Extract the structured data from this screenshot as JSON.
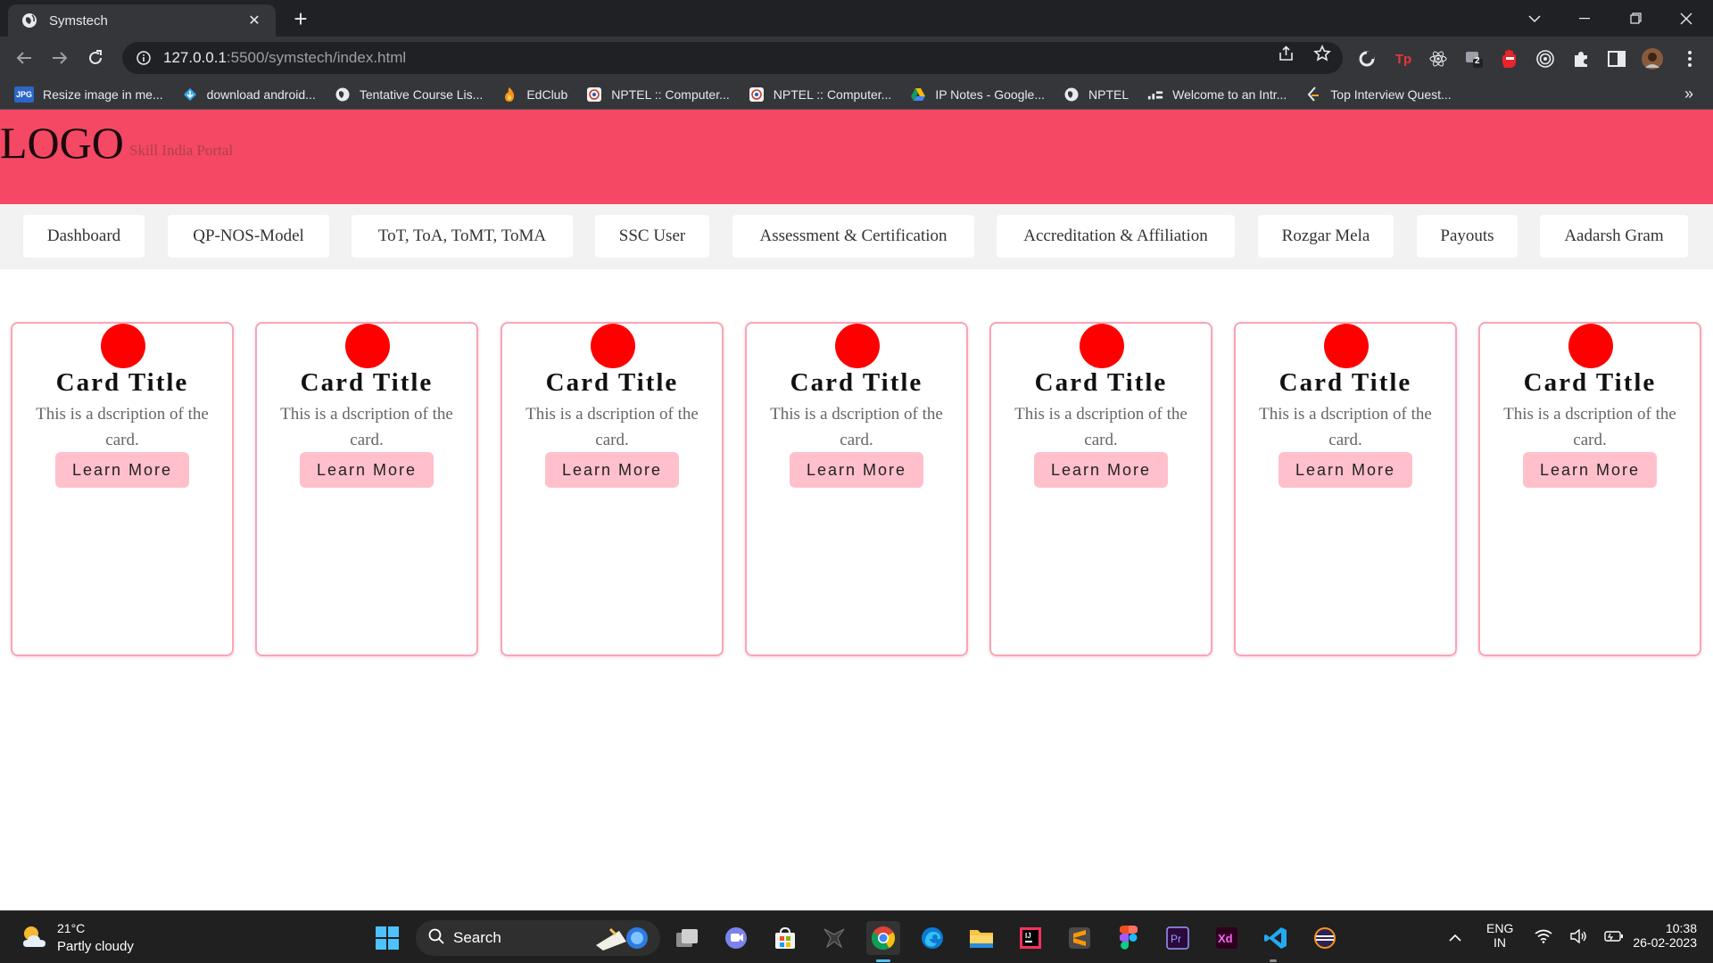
{
  "browser": {
    "tab": {
      "title": "Symstech",
      "favicon": "globe-icon"
    },
    "address": {
      "host": "127.0.0.1",
      "path": ":5500/symstech/index.html"
    },
    "bookmarks": [
      {
        "label": "Resize image in me...",
        "icon": "jpg-icon"
      },
      {
        "label": "download android...",
        "icon": "download-icon"
      },
      {
        "label": "Tentative Course Lis...",
        "icon": "globe-icon"
      },
      {
        "label": "EdClub",
        "icon": "edclub-icon"
      },
      {
        "label": "NPTEL :: Computer...",
        "icon": "nptel-icon"
      },
      {
        "label": "NPTEL :: Computer...",
        "icon": "nptel-icon"
      },
      {
        "label": "IP Notes - Google...",
        "icon": "drive-icon"
      },
      {
        "label": "NPTEL",
        "icon": "globe-icon"
      },
      {
        "label": "Welcome to an Intr...",
        "icon": "chart-icon"
      },
      {
        "label": "Top Interview Quest...",
        "icon": "leetcode-icon"
      }
    ],
    "bookmarks_more": "»",
    "extension_badge": "2"
  },
  "page": {
    "logo": "LOGO",
    "portal_name": "Skill India Portal",
    "nav": [
      "Dashboard",
      "QP-NOS-Model",
      "ToT, ToA, ToMT, ToMA",
      "SSC User",
      "Assessment & Certification",
      "Accreditation & Affiliation",
      "Rozgar Mela",
      "Payouts",
      "Aadarsh Gram"
    ],
    "cards": [
      {
        "title": "Card Title",
        "description": "This is a dscription of the card.",
        "button": "Learn More"
      },
      {
        "title": "Card Title",
        "description": "This is a dscription of the card.",
        "button": "Learn More"
      },
      {
        "title": "Card Title",
        "description": "This is a dscription of the card.",
        "button": "Learn More"
      },
      {
        "title": "Card Title",
        "description": "This is a dscription of the card.",
        "button": "Learn More"
      },
      {
        "title": "Card Title",
        "description": "This is a dscription of the card.",
        "button": "Learn More"
      },
      {
        "title": "Card Title",
        "description": "This is a dscription of the card.",
        "button": "Learn More"
      },
      {
        "title": "Card Title",
        "description": "This is a dscription of the card.",
        "button": "Learn More"
      }
    ],
    "colors": {
      "header": "#f44865",
      "circle": "#ff0000",
      "button": "#ffc0cb",
      "card_border": "#f7a6b6"
    }
  },
  "taskbar": {
    "weather": {
      "temp": "21°C",
      "desc": "Partly cloudy"
    },
    "search_label": "Search",
    "lang": {
      "line1": "ENG",
      "line2": "IN"
    },
    "clock": {
      "time": "10:38",
      "date": "26-02-2023"
    },
    "pinned": [
      "start-icon",
      "widgets-icon",
      "task-view-icon",
      "teams-icon",
      "store-icon",
      "acer-icon",
      "chrome-icon",
      "edge-icon",
      "file-explorer-icon",
      "intellij-icon",
      "sublime-icon",
      "figma-icon",
      "premiere-icon",
      "xd-icon",
      "vscode-icon",
      "eclipse-icon"
    ]
  }
}
